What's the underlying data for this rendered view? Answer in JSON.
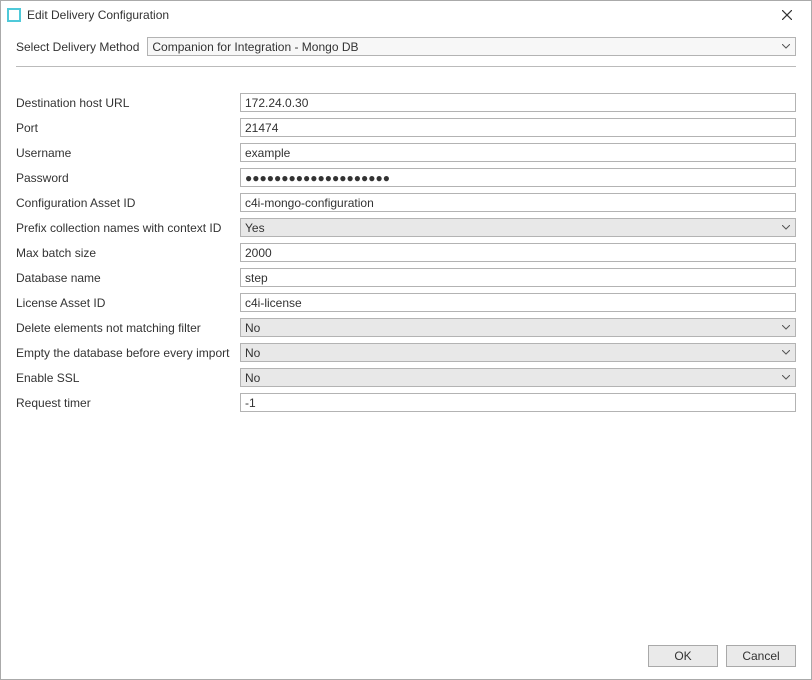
{
  "window": {
    "title": "Edit Delivery Configuration"
  },
  "method": {
    "label": "Select Delivery Method",
    "value": "Companion for Integration - Mongo DB"
  },
  "fields": {
    "destHostUrl": {
      "label": "Destination host URL",
      "value": "172.24.0.30"
    },
    "port": {
      "label": "Port",
      "value": "21474"
    },
    "username": {
      "label": "Username",
      "value": "example"
    },
    "password": {
      "label": "Password",
      "value": "●●●●●●●●●●●●●●●●●●●●"
    },
    "configAssetId": {
      "label": "Configuration Asset ID",
      "value": "c4i-mongo-configuration"
    },
    "prefixCollection": {
      "label": "Prefix collection names with context ID",
      "value": "Yes"
    },
    "maxBatchSize": {
      "label": "Max batch size",
      "value": "2000"
    },
    "databaseName": {
      "label": "Database name",
      "value": "step"
    },
    "licenseAssetId": {
      "label": "License Asset ID",
      "value": "c4i-license"
    },
    "deleteNotMatching": {
      "label": "Delete elements not matching filter",
      "value": "No"
    },
    "emptyBeforeImport": {
      "label": "Empty the database before every import",
      "value": "No"
    },
    "enableSsl": {
      "label": "Enable SSL",
      "value": "No"
    },
    "requestTimer": {
      "label": "Request timer",
      "value": "-1"
    }
  },
  "buttons": {
    "ok": "OK",
    "cancel": "Cancel"
  }
}
